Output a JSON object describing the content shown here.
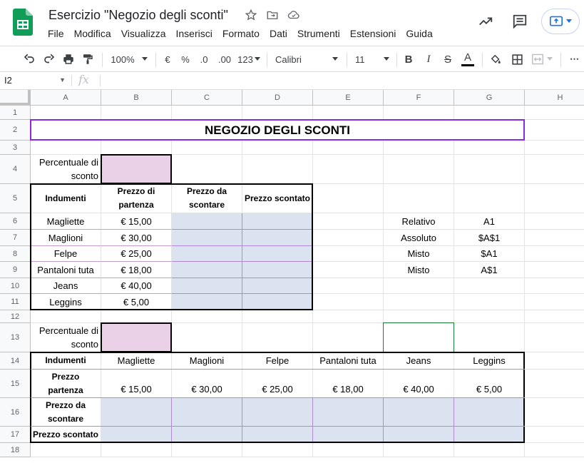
{
  "app": {
    "doc_title": "Esercizio \"Negozio degli sconti\"",
    "menu": [
      "File",
      "Modifica",
      "Visualizza",
      "Inserisci",
      "Formato",
      "Dati",
      "Strumenti",
      "Estensioni",
      "Guida"
    ]
  },
  "toolbar": {
    "zoom": "100%",
    "currency": "€",
    "percent": "%",
    "dec_decrease": ".0",
    "dec_increase": ".00",
    "number_format": "123",
    "font": "Calibri",
    "font_size": "11"
  },
  "formula_bar": {
    "cell_ref": "I2",
    "fx": "fx",
    "value": ""
  },
  "columns": [
    "A",
    "B",
    "C",
    "D",
    "E",
    "F",
    "G",
    "H"
  ],
  "rows": [
    "1",
    "2",
    "3",
    "4",
    "5",
    "6",
    "7",
    "8",
    "9",
    "10",
    "11",
    "12",
    "13",
    "14",
    "15",
    "16",
    "17",
    "18"
  ],
  "sheet": {
    "title": "NEGOZIO DEGLI SCONTI",
    "pct_label": "Percentuale di\nsconto",
    "table1": {
      "headers": [
        "Indumenti",
        "Prezzo di\npartenza",
        "Prezzo da\nscontare",
        "Prezzo scontato"
      ],
      "items": [
        {
          "name": "Magliette",
          "price": "€ 15,00"
        },
        {
          "name": "Maglioni",
          "price": "€ 30,00"
        },
        {
          "name": "Felpe",
          "price": "€ 25,00"
        },
        {
          "name": "Pantaloni tuta",
          "price": "€ 18,00"
        },
        {
          "name": "Jeans",
          "price": "€ 40,00"
        },
        {
          "name": "Leggins",
          "price": "€ 5,00"
        }
      ]
    },
    "refs": [
      {
        "type": "Relativo",
        "ref": "A1"
      },
      {
        "type": "Assoluto",
        "ref": "$A$1"
      },
      {
        "type": "Misto",
        "ref": "$A1"
      },
      {
        "type": "Misto",
        "ref": "A$1"
      }
    ],
    "table2": {
      "row_labels": [
        "Indumenti",
        "Prezzo\npartenza",
        "Prezzo da\nscontare",
        "Prezzo scontato"
      ],
      "items": [
        "Magliette",
        "Maglioni",
        "Felpe",
        "Pantaloni tuta",
        "Jeans",
        "Leggins"
      ],
      "prices": [
        "€ 15,00",
        "€ 30,00",
        "€ 25,00",
        "€ 18,00",
        "€ 40,00",
        "€ 5,00"
      ]
    }
  },
  "colors": {
    "pink_fill": "#ead1e8",
    "blue_fill": "#dce3f0",
    "purple_border": "#8a2be2",
    "selection": "#188038",
    "sheets_green": "#0f9d58"
  }
}
